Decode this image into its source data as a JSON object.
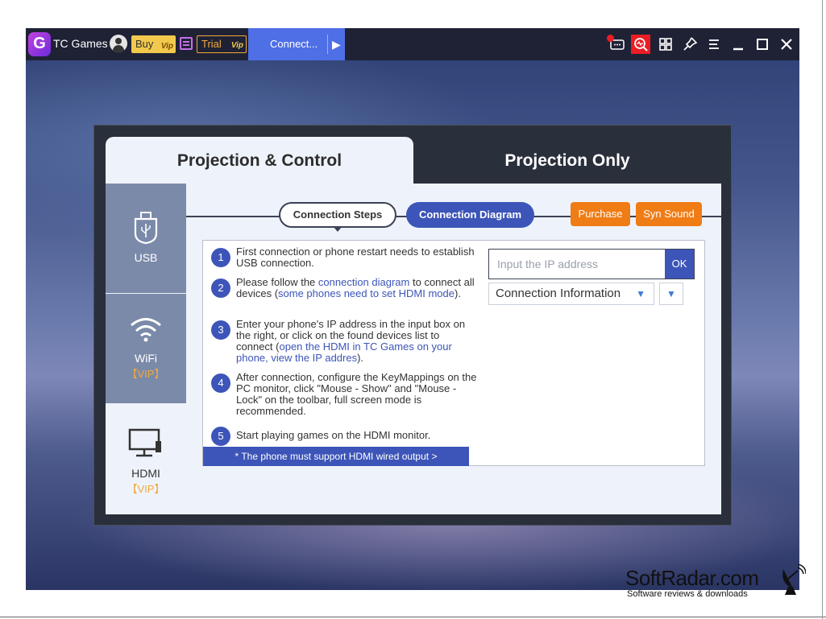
{
  "titlebar": {
    "app_title": "TC Games",
    "logo_letter": "G",
    "buy_label": "Buy",
    "trial_label": "Trial",
    "vip_mark": "Vip",
    "connect_tab_label": "Connect...",
    "connect_tab_arrow": "▶"
  },
  "dialog": {
    "tab_active": "Projection & Control",
    "tab_inactive": "Projection Only"
  },
  "sidebar": {
    "usb_label": "USB",
    "wifi_label": "WiFi",
    "wifi_vip": "【VIP】",
    "hdmi_label": "HDMI",
    "hdmi_vip": "【VIP】"
  },
  "subtabs": {
    "steps": "Connection Steps",
    "diagram": "Connection Diagram",
    "purchase": "Purchase",
    "syn_sound": "Syn Sound"
  },
  "steps": [
    {
      "num": "1",
      "text": "First connection or phone restart needs to establish USB connection."
    },
    {
      "num": "2",
      "pre": "Please follow the ",
      "link1": "connection diagram",
      "mid": " to connect all devices (",
      "link2": "some phones need to set HDMI mode",
      "post": ")."
    },
    {
      "num": "3",
      "pre": "Enter your phone's IP address in the input box on the right, or click on the found devices list to connect (",
      "link": "open the HDMI in TC Games on your phone, view the IP addres",
      "post": ")."
    },
    {
      "num": "4",
      "text": "After connection, configure the KeyMappings on the PC monitor, click \"Mouse - Show\" and \"Mouse - Lock\" on the toolbar, full screen mode is recommended."
    },
    {
      "num": "5",
      "text": "Start playing games on the HDMI monitor."
    }
  ],
  "hdmi_note": "* The phone must support HDMI wired output",
  "hdmi_note_arrow": ">",
  "ip_input": {
    "placeholder": "Input the IP address",
    "value": ""
  },
  "ok_label": "OK",
  "connection_info": "Connection Information",
  "watermark": {
    "title": "SoftRadar.com",
    "subtitle": "Software reviews & downloads"
  }
}
